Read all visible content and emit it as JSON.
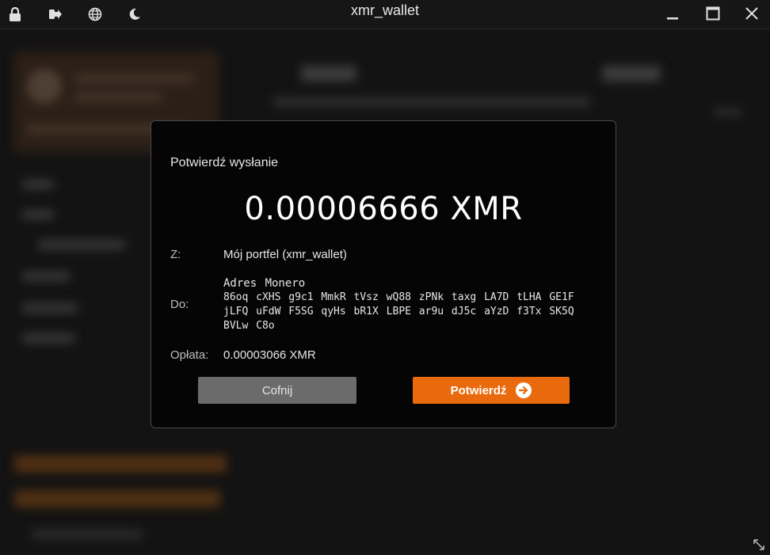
{
  "window": {
    "title": "xmr_wallet"
  },
  "titlebar": {
    "left_icons": [
      "lock-icon",
      "logout-icon",
      "globe-icon",
      "moon-icon"
    ],
    "controls": [
      "minimize-icon",
      "maximize-icon",
      "close-icon"
    ]
  },
  "dialog": {
    "title": "Potwierdź wysłanie",
    "amount": "0.00006666 XMR",
    "from_label": "Z:",
    "from_value": "Mój portfel (xmr_wallet)",
    "to_label": "Do:",
    "to_address_type": "Adres Monero",
    "to_address": "86oq cXHS g9c1 MmkR tVsz wQ88 zPNk taxg LA7D tLHA GE1F jLFQ uFdW F5SG qyHs bR1X LBPE ar9u dJ5c aYzD f3Tx SK5Q BVLw C8o",
    "fee_label": "Opłata:",
    "fee_value": "0.00003066 XMR",
    "back_button": "Cofnij",
    "confirm_button": "Potwierdź"
  },
  "colors": {
    "accent": "#e96a0c",
    "modal_bg": "#050505",
    "back_button_bg": "#6b6b6b"
  }
}
